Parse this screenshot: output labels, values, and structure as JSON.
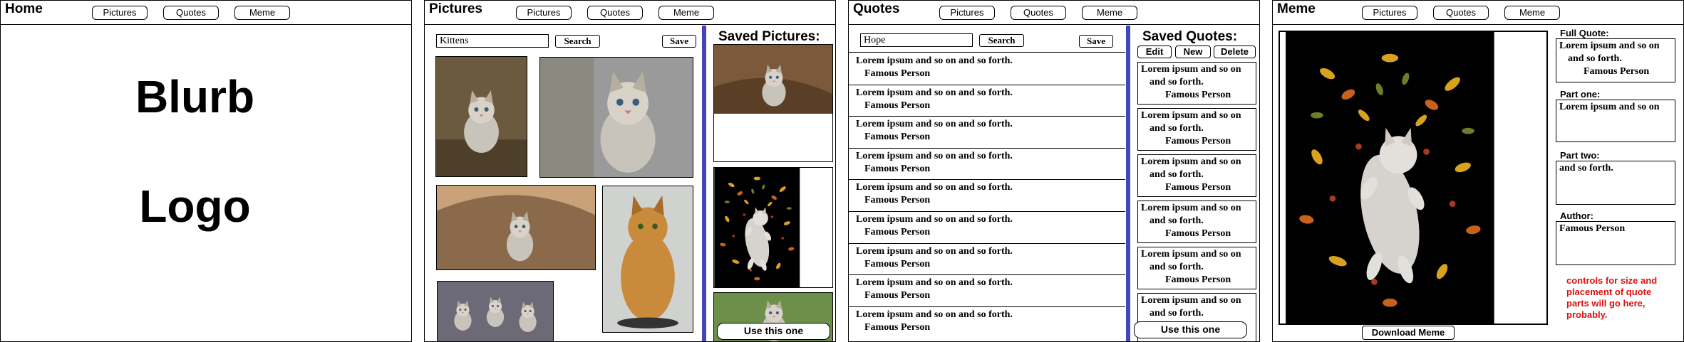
{
  "nav": {
    "pictures": "Pictures",
    "quotes": "Quotes",
    "meme": "Meme"
  },
  "home": {
    "title": "Home",
    "blurb": "Blurb",
    "logo": "Logo"
  },
  "pictures": {
    "title": "Pictures",
    "search_value": "Kittens",
    "search_label": "Search",
    "save_label": "Save",
    "saved_title": "Saved Pictures:",
    "use_label": "Use this one"
  },
  "quotes": {
    "title": "Quotes",
    "search_value": "Hope",
    "search_label": "Search",
    "save_label": "Save",
    "saved_title": "Saved Quotes:",
    "edit_label": "Edit",
    "new_label": "New",
    "delete_label": "Delete",
    "quote_text": "Lorem ipsum and so on and so forth.",
    "author": "Famous Person",
    "use_label": "Use this one",
    "saved_line1": "Lorem ipsum and so on",
    "saved_line2": "and so forth."
  },
  "meme": {
    "title": "Meme",
    "full_quote_label": "Full Quote:",
    "full_quote_line1": "Lorem ipsum and so on",
    "full_quote_line2": "and so forth.",
    "full_quote_author": "Famous Person",
    "part_one_label": "Part one:",
    "part_one_value": "Lorem ipsum and so on",
    "part_two_label": "Part two:",
    "part_two_value": "and so forth.",
    "author_label": "Author:",
    "author_value": "Famous Person",
    "note": "controls for size and placement of quote parts will go here, probably.",
    "download_label": "Download Meme"
  },
  "colors": {
    "accent_bar": "#4444bb",
    "note": "#dd1111",
    "meme_bg": "#000000"
  }
}
